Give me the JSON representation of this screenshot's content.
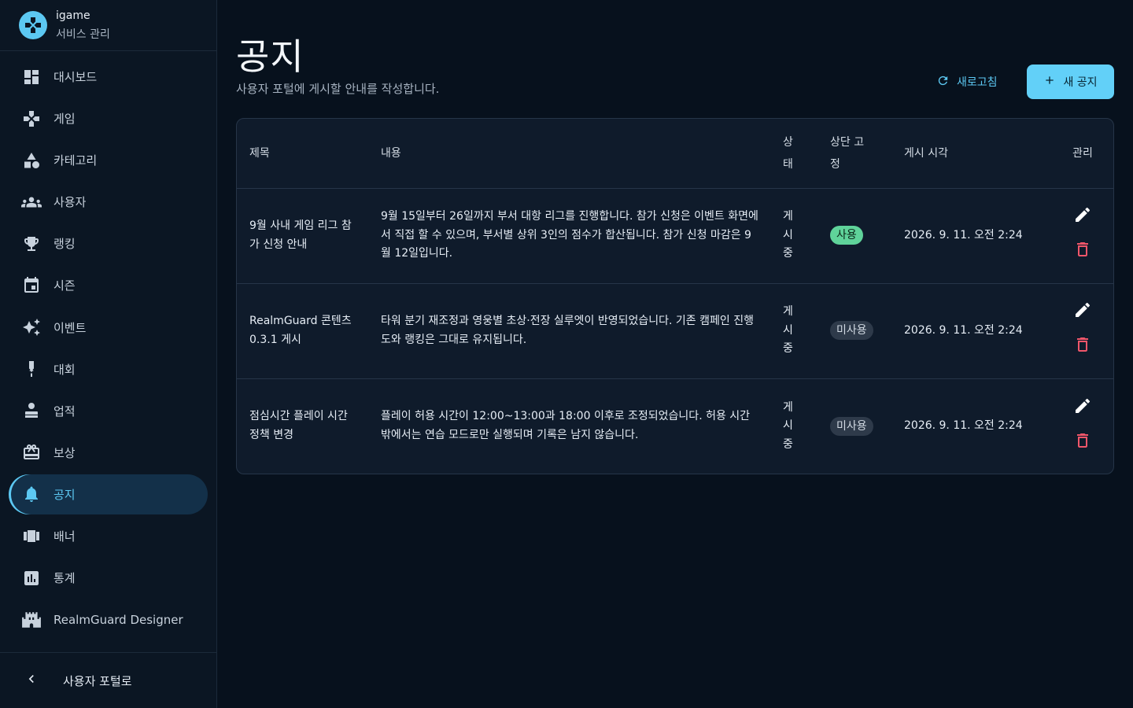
{
  "brand": {
    "name": "igame",
    "subtitle": "서비스 관리"
  },
  "nav": [
    {
      "label": "대시보드",
      "icon": "dashboard-icon"
    },
    {
      "label": "게임",
      "icon": "gamepad-icon"
    },
    {
      "label": "카테고리",
      "icon": "category-icon"
    },
    {
      "label": "사용자",
      "icon": "users-icon"
    },
    {
      "label": "랭킹",
      "icon": "trophy-icon"
    },
    {
      "label": "시즌",
      "icon": "calendar-icon"
    },
    {
      "label": "이벤트",
      "icon": "sparkle-icon"
    },
    {
      "label": "대회",
      "icon": "medal-icon"
    },
    {
      "label": "업적",
      "icon": "achievement-icon"
    },
    {
      "label": "보상",
      "icon": "gift-icon"
    },
    {
      "label": "공지",
      "icon": "bell-icon",
      "active": true
    },
    {
      "label": "배너",
      "icon": "banner-icon"
    },
    {
      "label": "통계",
      "icon": "stats-icon"
    },
    {
      "label": "RealmGuard Designer",
      "icon": "castle-icon"
    }
  ],
  "footer": {
    "label": "사용자 포털로"
  },
  "page": {
    "title": "공지",
    "subtitle": "사용자 포털에 게시할 안내를 작성합니다."
  },
  "toolbar": {
    "refresh_label": "새로고침",
    "new_label": "새 공지"
  },
  "table": {
    "headers": {
      "title": "제목",
      "content": "내용",
      "status": "상\n태",
      "pinned": "상단 고\n정",
      "posted_at": "게시 시각",
      "manage": "관리"
    },
    "rows": [
      {
        "title": "9월 사내 게임 리그 참가 신청 안내",
        "content": "9월 15일부터 26일까지 부서 대항 리그를 진행합니다. 참가 신청은 이벤트 화면에서 직접 할 수 있으며, 부서별 상위 3인의 점수가 합산됩니다. 참가 신청 마감은 9월 12일입니다.",
        "status": "게\n시\n중",
        "pinned": "사용",
        "pinned_on": true,
        "posted_at": "2026. 9. 11. 오전 2:24"
      },
      {
        "title": "RealmGuard 콘텐츠 0.3.1 게시",
        "content": "타워 분기 재조정과 영웅별 초상·전장 실루엣이 반영되었습니다. 기존 캠페인 진행도와 랭킹은 그대로 유지됩니다.",
        "status": "게\n시\n중",
        "pinned": "미사용",
        "pinned_on": false,
        "posted_at": "2026. 9. 11. 오전 2:24"
      },
      {
        "title": "점심시간 플레이 시간 정책 변경",
        "content": "플레이 허용 시간이 12:00~13:00과 18:00 이후로 조정되었습니다. 허용 시간 밖에서는 연습 모드로만 실행되며 기록은 남지 않습니다.",
        "status": "게\n시\n중",
        "pinned": "미사용",
        "pinned_on": false,
        "posted_at": "2026. 9. 11. 오전 2:24"
      }
    ]
  },
  "colors": {
    "accent": "#5cc8f2",
    "danger": "#f0566a",
    "badge_on": "#5fd39a",
    "badge_off": "#2e3a4a"
  }
}
